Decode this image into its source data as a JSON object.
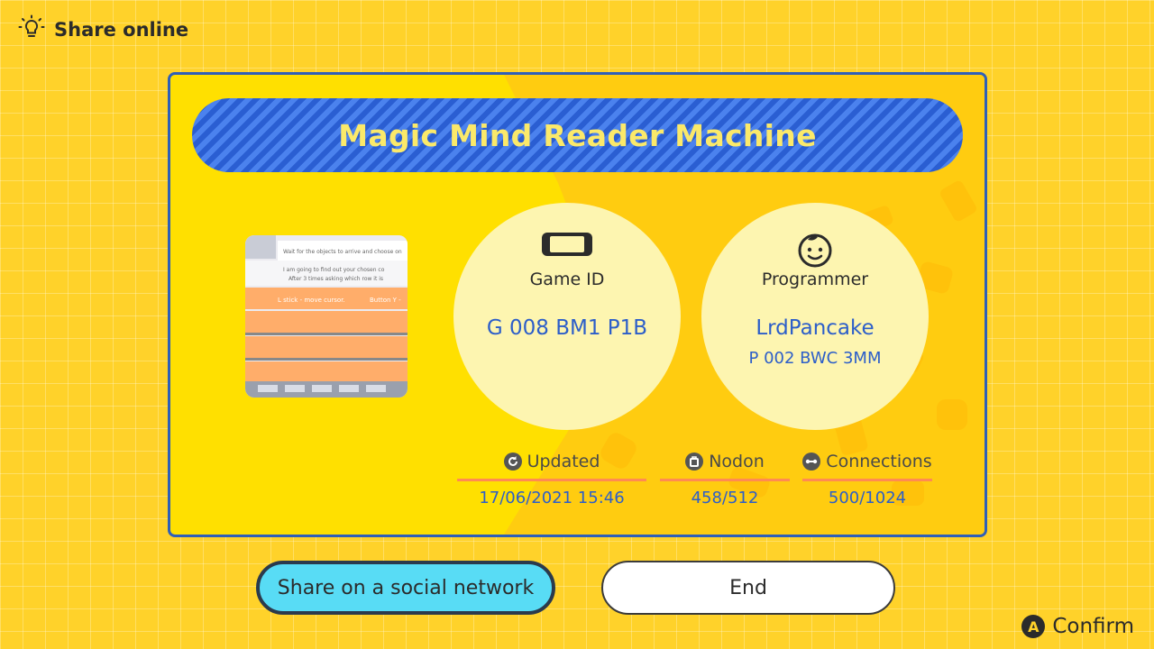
{
  "header": {
    "title": "Share online",
    "icon": "lightbulb-icon"
  },
  "game": {
    "title": "Magic Mind Reader Machine",
    "thumbnail_lines": [
      "Wait for the objects to arrive and choose on",
      "I am going to find out your chosen co",
      "After 3 times asking which row it is",
      "L stick - move cursor.",
      "Button Y -"
    ]
  },
  "game_id": {
    "label": "Game ID",
    "value": "G 008 BM1 P1B",
    "icon": "console-icon"
  },
  "programmer": {
    "label": "Programmer",
    "name": "LrdPancake",
    "id": "P 002 BWC 3MM",
    "icon": "face-icon"
  },
  "stats": {
    "updated": {
      "label": "Updated",
      "value": "17/06/2021 15:46",
      "icon": "refresh-icon"
    },
    "nodon": {
      "label": "Nodon",
      "value": "458/512",
      "icon": "nodon-icon"
    },
    "connections": {
      "label": "Connections",
      "value": "500/1024",
      "icon": "connection-icon"
    }
  },
  "buttons": {
    "share": "Share on a social network",
    "end": "End"
  },
  "footer": {
    "button_glyph": "A",
    "confirm": "Confirm"
  },
  "colors": {
    "background": "#ffd22a",
    "panel_border": "#2f5fb8",
    "title_bar": "#2f66d8",
    "title_text": "#fbe96a",
    "value_text": "#2c5ec9",
    "share_button": "#58dcf5",
    "stat_underline": "#ff8a53"
  }
}
